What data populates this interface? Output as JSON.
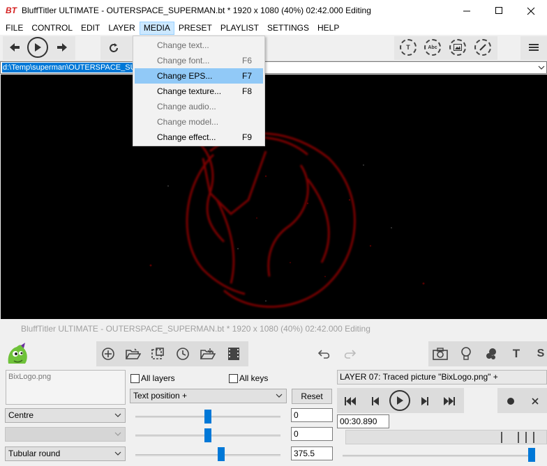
{
  "window": {
    "title": "BluffTitler ULTIMATE  - OUTERSPACE_SUPERMAN.bt * 1920 x 1080 (40%) 02:42.000 Editing",
    "app_icon": "BT",
    "minimize_icon": "minimize-icon",
    "maximize_icon": "maximize-icon",
    "close_icon": "close-icon"
  },
  "menubar": {
    "items": [
      {
        "label": "FILE"
      },
      {
        "label": "CONTROL"
      },
      {
        "label": "EDIT"
      },
      {
        "label": "LAYER"
      },
      {
        "label": "MEDIA"
      },
      {
        "label": "PRESET"
      },
      {
        "label": "PLAYLIST"
      },
      {
        "label": "SETTINGS"
      },
      {
        "label": "HELP"
      }
    ],
    "active": "MEDIA"
  },
  "toolbar": {
    "round_icons": [
      "T",
      "Abc",
      "",
      ""
    ]
  },
  "path_bar": {
    "value": "d:\\Temp\\superman\\OUTERSPACE_SUPERMAN.bt"
  },
  "media_menu": {
    "items": [
      {
        "label": "Change text...",
        "shortcut": "",
        "enabled": false
      },
      {
        "label": "Change font...",
        "shortcut": "F6",
        "enabled": false
      },
      {
        "label": "Change EPS...",
        "shortcut": "F7",
        "enabled": true
      },
      {
        "label": "Change texture...",
        "shortcut": "F8",
        "enabled": true
      },
      {
        "label": "Change audio...",
        "shortcut": "",
        "enabled": false
      },
      {
        "label": "Change model...",
        "shortcut": "",
        "enabled": false
      },
      {
        "label": "Change effect...",
        "shortcut": "F9",
        "enabled": true
      }
    ],
    "highlighted": "Change EPS..."
  },
  "bottom": {
    "title": "BluffTitler ULTIMATE  - OUTERSPACE_SUPERMAN.bt * 1920 x 1080 (40%) 02:42.000 Editing",
    "logo_file": "BixLogo.png",
    "all_layers_label": "All layers",
    "all_keys_label": "All keys",
    "property_select": "Text position +",
    "reset_label": "Reset",
    "select_centre": "Centre",
    "select_blank": "",
    "select_tubular": "Tubular round",
    "value_1": "0",
    "value_2": "0",
    "value_3": "375.5",
    "layer_label": "LAYER 07: Traced picture \"BixLogo.png\" +",
    "time_value": "00:30.890",
    "right_icons_text": "T",
    "right_icons_s": "S"
  }
}
